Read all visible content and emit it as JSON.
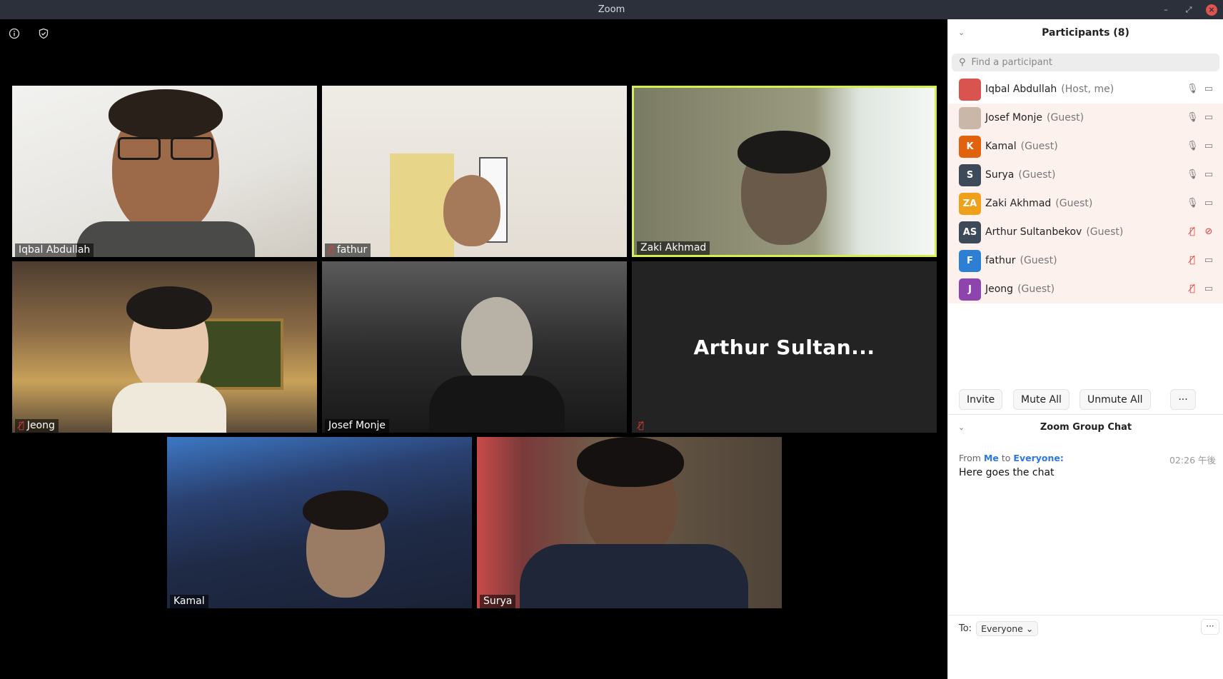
{
  "window": {
    "title": "Zoom"
  },
  "video_tiles": [
    {
      "name": "Iqbal Abdullah",
      "muted": false
    },
    {
      "name": "fathur",
      "muted": true
    },
    {
      "name": "Zaki Akhmad",
      "muted": false,
      "speaking": true
    },
    {
      "name": "Jeong",
      "muted": true
    },
    {
      "name": "Josef Monje",
      "muted": false
    },
    {
      "name": "Arthur Sultan...",
      "muted": true,
      "video_off": true
    },
    {
      "name": "Kamal",
      "muted": false
    },
    {
      "name": "Surya",
      "muted": false
    }
  ],
  "participants_panel": {
    "title": "Participants (8)",
    "search_placeholder": "Find a participant",
    "participants": [
      {
        "name": "Iqbal Abdullah",
        "role": "(Host, me)",
        "initials": "",
        "avatar_color": "#d9534f",
        "mic_muted": false,
        "video_off": false
      },
      {
        "name": "Josef Monje",
        "role": "(Guest)",
        "initials": "",
        "avatar_color": "#c9b8a8",
        "mic_muted": false,
        "video_off": false
      },
      {
        "name": "Kamal",
        "role": "(Guest)",
        "initials": "K",
        "avatar_color": "#e0620d",
        "mic_muted": false,
        "video_off": false
      },
      {
        "name": "Surya",
        "role": "(Guest)",
        "initials": "S",
        "avatar_color": "#3d4a5a",
        "mic_muted": false,
        "video_off": false
      },
      {
        "name": "Zaki Akhmad",
        "role": "(Guest)",
        "initials": "ZA",
        "avatar_color": "#f0a11c",
        "mic_muted": false,
        "video_off": false
      },
      {
        "name": "Arthur Sultanbekov",
        "role": "(Guest)",
        "initials": "AS",
        "avatar_color": "#3d4a5a",
        "mic_muted": true,
        "video_off": true
      },
      {
        "name": "fathur",
        "role": "(Guest)",
        "initials": "F",
        "avatar_color": "#2d7fd3",
        "mic_muted": true,
        "video_off": false
      },
      {
        "name": "Jeong",
        "role": "(Guest)",
        "initials": "J",
        "avatar_color": "#8e44ad",
        "mic_muted": true,
        "video_off": false
      }
    ],
    "buttons": {
      "invite": "Invite",
      "mute_all": "Mute All",
      "unmute_all": "Unmute All",
      "more": "···"
    }
  },
  "chat": {
    "title": "Zoom Group Chat",
    "messages": [
      {
        "from_label": "From",
        "sender": "Me",
        "to_label": "to",
        "recipient": "Everyone:",
        "time": "02:26 午後",
        "text": "Here goes the chat"
      }
    ],
    "to_label": "To:",
    "recipient_selected": "Everyone",
    "more": "···"
  }
}
